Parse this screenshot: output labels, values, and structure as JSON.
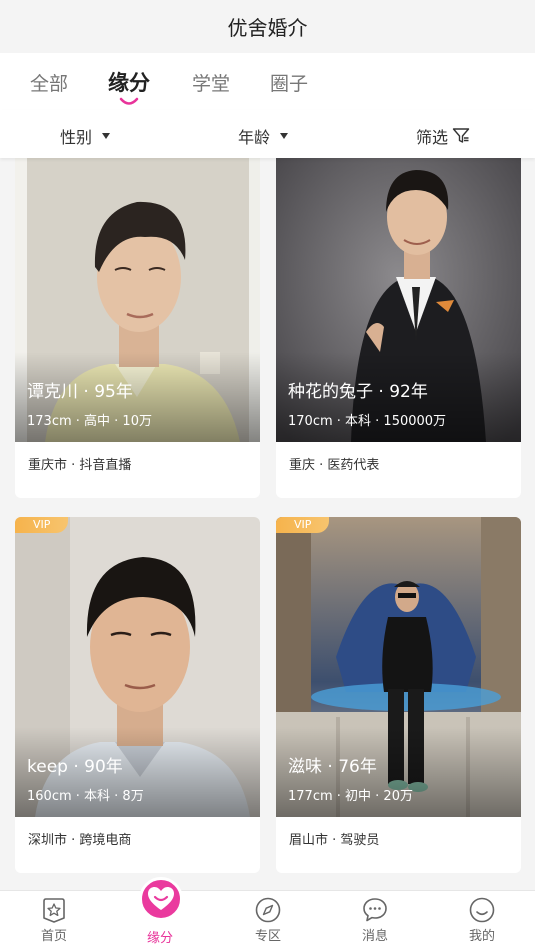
{
  "header": {
    "title": "优舍婚介"
  },
  "tabs": [
    {
      "label": "全部"
    },
    {
      "label": "缘分"
    },
    {
      "label": "学堂"
    },
    {
      "label": "圈子"
    }
  ],
  "filters": {
    "gender": "性别",
    "age": "年龄",
    "screen": "筛选"
  },
  "cards": [
    {
      "name": "谭克川 · 95年",
      "info": "173cm · 高中 · 10万",
      "foot": "重庆市 · 抖音直播",
      "vip": ""
    },
    {
      "name": "种花的兔子 · 92年",
      "info": "170cm · 本科 · 150000万",
      "foot": "重庆 · 医药代表",
      "vip": ""
    },
    {
      "name": "keep · 90年",
      "info": "160cm · 本科 · 8万",
      "foot": "深圳市 · 跨境电商",
      "vip": "VIP"
    },
    {
      "name": "滋味 · 76年",
      "info": "177cm · 初中 · 20万",
      "foot": "眉山市 · 驾驶员",
      "vip": "VIP"
    }
  ],
  "nav": {
    "home": "首页",
    "match": "缘分",
    "zone": "专区",
    "message": "消息",
    "mine": "我的"
  },
  "colors": {
    "accent": "#e8339a",
    "vip": "#f6b34c"
  }
}
